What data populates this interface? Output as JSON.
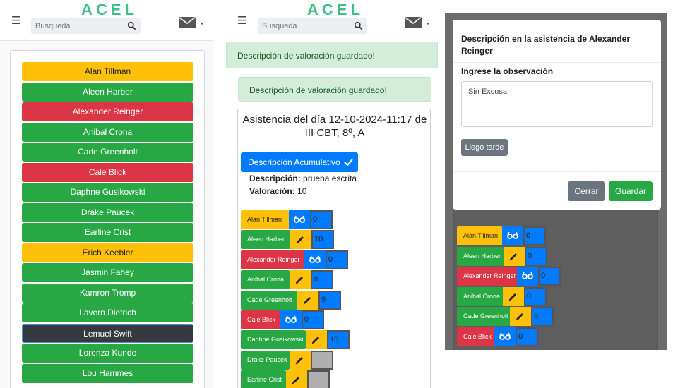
{
  "brand": {
    "logo_text": "ACEL",
    "accent": "#3fbf86"
  },
  "header": {
    "search_placeholder": "Busqueda"
  },
  "colors": {
    "yellow": "#ffc107",
    "green": "#28a745",
    "red": "#dc3545",
    "dark": "#343a40",
    "blue": "#007bff"
  },
  "panel1": {
    "students": [
      {
        "name": "Alan Tillman",
        "color": "yellow"
      },
      {
        "name": "Aleen Harber",
        "color": "green"
      },
      {
        "name": "Alexander Reinger",
        "color": "red"
      },
      {
        "name": "Anibal Crona",
        "color": "green"
      },
      {
        "name": "Cade Greenholt",
        "color": "green"
      },
      {
        "name": "Cale Blick",
        "color": "red"
      },
      {
        "name": "Daphne Gusikowski",
        "color": "green"
      },
      {
        "name": "Drake Paucek",
        "color": "green"
      },
      {
        "name": "Earline Crist",
        "color": "green"
      },
      {
        "name": "Erich Keebler",
        "color": "yellow"
      },
      {
        "name": "Jasmin Fahey",
        "color": "green"
      },
      {
        "name": "Kamron Tromp",
        "color": "green"
      },
      {
        "name": "Lavern Dietrich",
        "color": "green"
      },
      {
        "name": "Lemuel Swift",
        "color": "dark"
      },
      {
        "name": "Lorenza Kunde",
        "color": "green"
      },
      {
        "name": "Lou Hammes",
        "color": "green"
      }
    ]
  },
  "panel2": {
    "alert_top": "Descripción de valoración guardado!",
    "alert_inner": "Descripción de valoración guardado!",
    "title": "Asistencia del día 12-10-2024-11:17 de III CBT, 8º, A",
    "acum_button": "Descripción Acumulativo",
    "description_label": "Descripción:",
    "description_value": "prueba escrita",
    "valoracion_label": "Valoración:",
    "valoracion_value": "10",
    "rows": [
      {
        "name": "Alan Tillman",
        "color": "yellow",
        "icon": "glasses-icon",
        "value": "0"
      },
      {
        "name": "Aleen Harber",
        "color": "green",
        "icon": "pencil-icon",
        "value": "10"
      },
      {
        "name": "Alexander Reinger",
        "color": "red",
        "icon": "glasses-icon",
        "value": "0"
      },
      {
        "name": "Anibal Crona",
        "color": "green",
        "icon": "pencil-icon",
        "value": "8"
      },
      {
        "name": "Cade Greenholt",
        "color": "green",
        "icon": "pencil-icon",
        "value": "9"
      },
      {
        "name": "Cale Blick",
        "color": "red",
        "icon": "glasses-icon",
        "value": "0"
      },
      {
        "name": "Daphne Gusikowski",
        "color": "green",
        "icon": "pencil-icon",
        "value": "10"
      },
      {
        "name": "Drake Paucek",
        "color": "green",
        "icon": "pencil-icon",
        "value": ""
      },
      {
        "name": "Earline Crist",
        "color": "green",
        "icon": "pencil-icon",
        "value": ""
      }
    ]
  },
  "panel3": {
    "modal_title": "Descripción en la asistencia de Alexander Reinger",
    "field_label": "Ingrese la observación",
    "textarea_value": "Sin Excusa",
    "late_button": "Llego tarde",
    "close_button": "Cerrar",
    "save_button": "Guardar",
    "bg_rows": [
      {
        "name": "Alan Tillman",
        "color": "yellow",
        "icon": "glasses-icon",
        "value": "0"
      },
      {
        "name": "Aleen Harber",
        "color": "green",
        "icon": "pencil-icon",
        "value": "0"
      },
      {
        "name": "Alexander Reinger",
        "color": "red",
        "icon": "glasses-icon",
        "value": "0"
      },
      {
        "name": "Anibal Crona",
        "color": "green",
        "icon": "pencil-icon",
        "value": "0"
      },
      {
        "name": "Cade Greenholt",
        "color": "green",
        "icon": "pencil-icon",
        "value": "0"
      },
      {
        "name": "Cale Blick",
        "color": "red",
        "icon": "glasses-icon",
        "value": "0"
      }
    ]
  }
}
